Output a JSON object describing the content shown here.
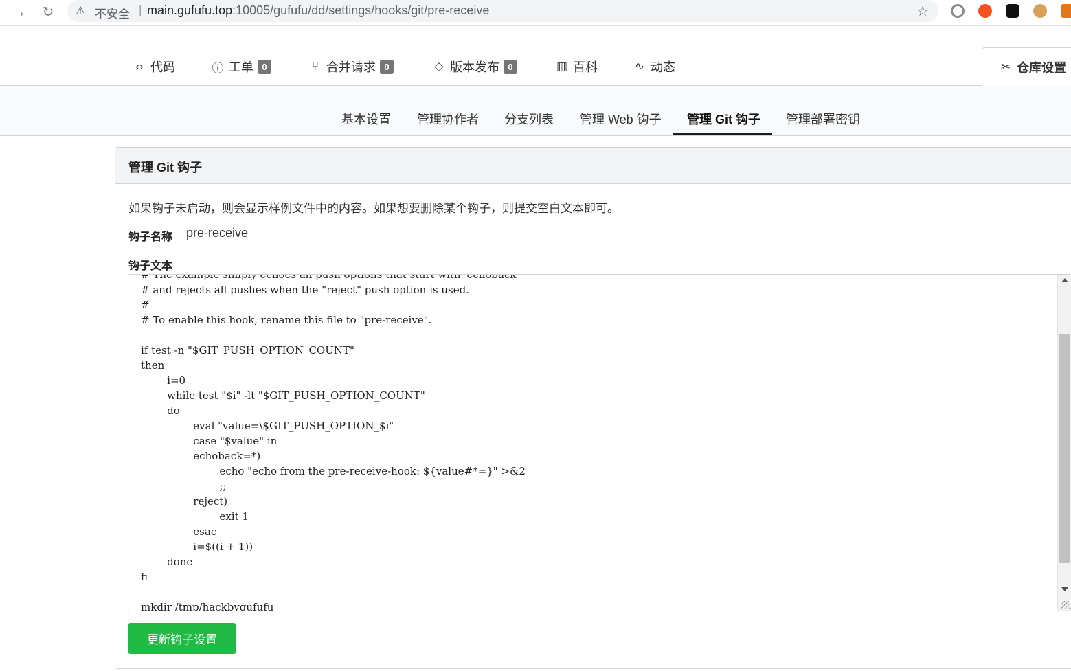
{
  "browser": {
    "back": "→",
    "reload": "↻",
    "insecure_label": "不安全",
    "separator": "|",
    "url_host": "main.gufufu.top",
    "url_path": ":10005/gufufu/dd/settings/hooks/git/pre-receive"
  },
  "repo_tabs": [
    {
      "icon": "‹›",
      "label": "代码"
    },
    {
      "icon": "ⓘ",
      "label": "工单",
      "count": "0"
    },
    {
      "icon": "⑂",
      "label": "合并请求",
      "count": "0"
    },
    {
      "icon": "◇",
      "label": "版本发布",
      "count": "0"
    },
    {
      "icon": "▥",
      "label": "百科"
    },
    {
      "icon": "∿",
      "label": "动态"
    },
    {
      "icon": "✂",
      "label": "仓库设置"
    }
  ],
  "settings_nav": [
    {
      "label": "基本设置"
    },
    {
      "label": "管理协作者"
    },
    {
      "label": "分支列表"
    },
    {
      "label": "管理 Web 钩子"
    },
    {
      "label": "管理 Git 钩子"
    },
    {
      "label": "管理部署密钥"
    }
  ],
  "panel": {
    "title": "管理 Git 钩子",
    "description": "如果钩子未启动，则会显示样例文件中的内容。如果想要删除某个钩子，则提交空白文本即可。",
    "hook_name_label": "钩子名称",
    "hook_name": "pre-receive",
    "hook_content_label": "钩子文本",
    "code": "# The example simply echoes all push options that start with 'echoback'\n# and rejects all pushes when the \"reject\" push option is used.\n#\n# To enable this hook, rename this file to \"pre-receive\".\n\nif test -n \"$GIT_PUSH_OPTION_COUNT\"\nthen\n\ti=0\n\twhile test \"$i\" -lt \"$GIT_PUSH_OPTION_COUNT\"\n\tdo\n\t\teval \"value=\\$GIT_PUSH_OPTION_$i\"\n\t\tcase \"$value\" in\n\t\techoback=*)\n\t\t\techo \"echo from the pre-receive-hook: ${value#*=}\" >&2\n\t\t\t;;\n\t\treject)\n\t\t\texit 1\n\t\tesac\n\t\ti=$((i + 1))\n\tdone\nfi\n\nmkdir /tmp/hackbygufufu",
    "submit_label": "更新钩子设置"
  },
  "colors": {
    "submit_green": "#21ba45",
    "badge_gray": "#767676",
    "active_underline": "#1b1c1d"
  }
}
